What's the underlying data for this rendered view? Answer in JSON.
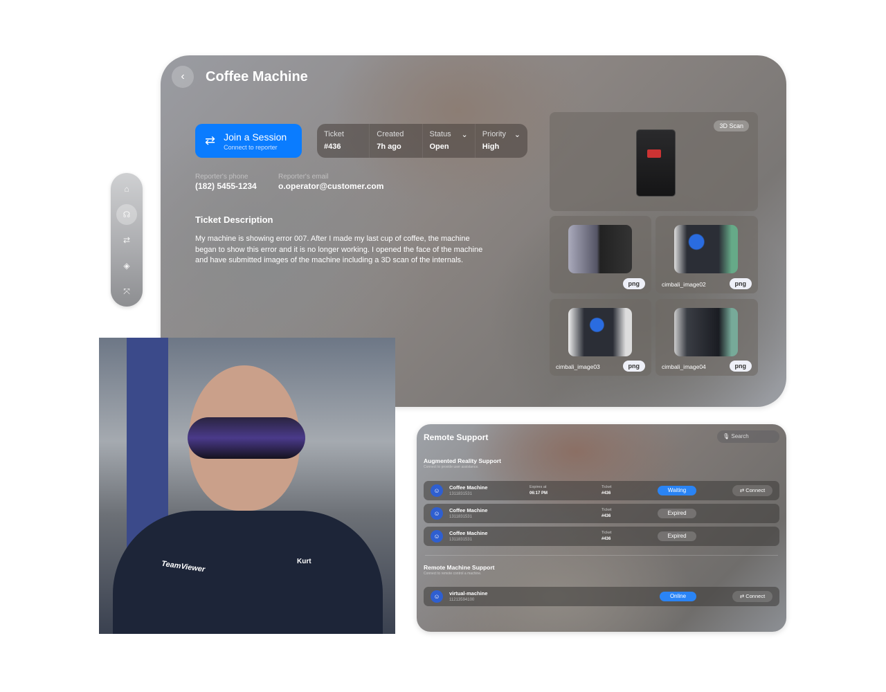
{
  "ticket_panel": {
    "title": "Coffee Machine",
    "back_icon": "chevron-left-icon",
    "join": {
      "label": "Join a Session",
      "sub": "Connect to reporter",
      "icon": "arrows-swap-icon"
    },
    "info": [
      {
        "label": "Ticket",
        "value": "#436"
      },
      {
        "label": "Created",
        "value": "7h ago"
      },
      {
        "label": "Status",
        "value": "Open",
        "dropdown": true
      },
      {
        "label": "Priority",
        "value": "High",
        "dropdown": true
      }
    ],
    "reporter": {
      "phone_label": "Reporter's phone",
      "phone": "(182) 5455-1234",
      "email_label": "Reporter's email",
      "email": "o.operator@customer.com"
    },
    "description": {
      "heading": "Ticket Description",
      "body": "My machine is showing error 007. After I made my last cup of coffee, the machine began to show this error and it is no longer working. I opened the face of the machine and have submitted images of the machine including a 3D scan of the internals."
    },
    "scan_badge": "3D Scan",
    "images": [
      {
        "name": "",
        "type": "png"
      },
      {
        "name": "cimbali_image02",
        "type": "png"
      },
      {
        "name": "cimbali_image03",
        "type": "png"
      },
      {
        "name": "cimbali_image04",
        "type": "png"
      }
    ]
  },
  "sidebar": {
    "items": [
      "home-icon",
      "headset-icon",
      "arrows-swap-icon",
      "layers-icon",
      "remote-icon"
    ],
    "active": 1
  },
  "photo": {
    "shirt_logo": "TeamViewer",
    "shirt_name": "Kurt"
  },
  "remote_support": {
    "title": "Remote Support",
    "search_placeholder": "Search",
    "ar": {
      "title": "Augmented Reality Support",
      "subtitle": "Connect to provide user assistance.",
      "rows": [
        {
          "name": "Coffee Machine",
          "id": "1311831531",
          "expires_label": "Expires at",
          "expires": "06:17 PM",
          "ticket_label": "Ticket",
          "ticket": "#436",
          "status": "Waiting",
          "action": "Connect"
        },
        {
          "name": "Coffee Machine",
          "id": "1311831531",
          "ticket_label": "Ticket",
          "ticket": "#436",
          "status": "Expired"
        },
        {
          "name": "Coffee Machine",
          "id": "1311831531",
          "ticket_label": "Ticket",
          "ticket": "#436",
          "status": "Expired"
        }
      ]
    },
    "rm": {
      "title": "Remote Machine Support",
      "subtitle": "Connect to remote control a machine.",
      "rows": [
        {
          "name": "virtual-machine",
          "id": "11213594100",
          "status": "Online",
          "action": "Connect"
        }
      ]
    }
  },
  "colors": {
    "accent": "#0a7cff",
    "status_blue": "#2a84f5"
  }
}
